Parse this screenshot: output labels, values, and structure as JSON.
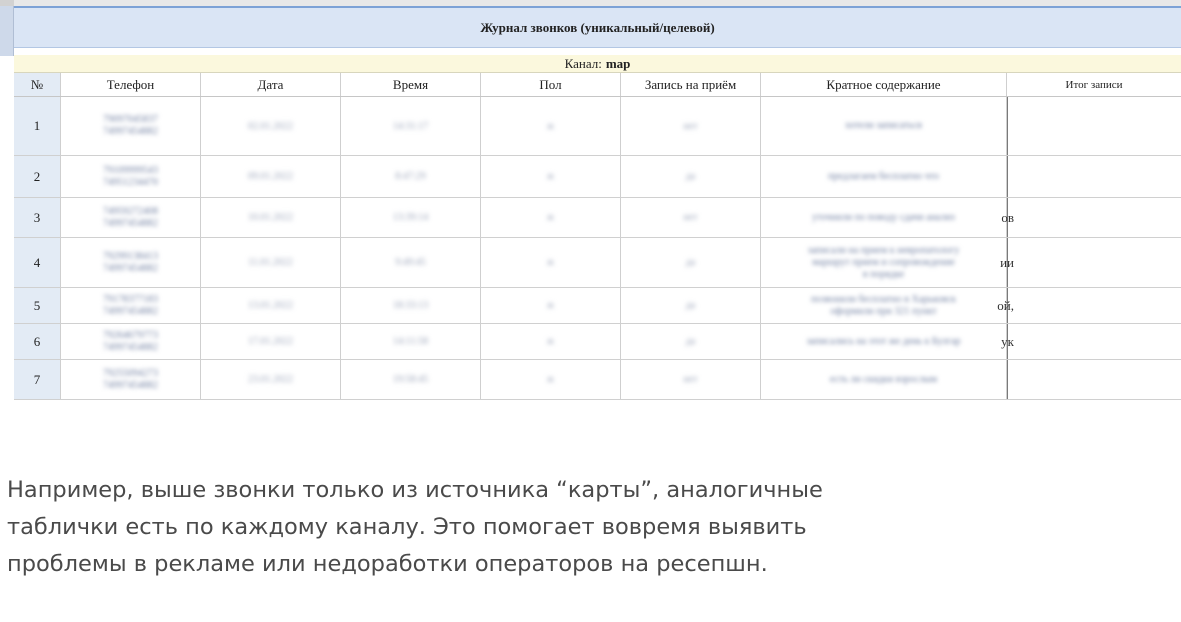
{
  "journal": {
    "title": "Журнал звонков (уникальный/целевой)",
    "channel_label": "Канал:",
    "channel_value": "map"
  },
  "table": {
    "columns": [
      "№",
      "Телефон",
      "Дата",
      "Время",
      "Пол",
      "Запись на приём",
      "Кратное содержание",
      "Итог записи"
    ],
    "rows": [
      {
        "num": "1",
        "phone": [
          "79097045837",
          "74997454882"
        ],
        "date": "02.01.2022",
        "time": "14:31:17",
        "sex": "ж",
        "appt": "нет",
        "summary": [
          "хотели записаться"
        ],
        "tail": ""
      },
      {
        "num": "2",
        "phone": [
          "79109999543",
          "74951234470"
        ],
        "date": "09.01.2022",
        "time": "8:47:29",
        "sex": "ж",
        "appt": "да",
        "summary": [
          "предлагаем бесплатно что"
        ],
        "tail": ""
      },
      {
        "num": "3",
        "phone": [
          "74959272408",
          "74997454882"
        ],
        "date": "10.01.2022",
        "time": "13:39:14",
        "sex": "ж",
        "appt": "нет",
        "summary": [
          "уточнили по поводу сдачи анализ"
        ],
        "tail": "ов"
      },
      {
        "num": "4",
        "phone": [
          "79299138413",
          "74997454882"
        ],
        "date": "11.01.2022",
        "time": "9:49:45",
        "sex": "ж",
        "appt": "да",
        "summary": [
          "записали на прием к невропатологу",
          "маршрут прием и сопровождение",
          "в порядке"
        ],
        "tail": "ии"
      },
      {
        "num": "5",
        "phone": [
          "79178377183",
          "74997454882"
        ],
        "date": "13.01.2022",
        "time": "18:33:13",
        "sex": "ж",
        "appt": "да",
        "summary": [
          "позвонили бесплатно в Харьковск",
          "оформили при 321 пункт"
        ],
        "tail": "ой,"
      },
      {
        "num": "6",
        "phone": [
          "79264679773",
          "74997454882"
        ],
        "date": "17.01.2022",
        "time": "14:11:58",
        "sex": "ж",
        "appt": "да",
        "summary": [
          "записались на этот же день к Булгар"
        ],
        "tail": "ук"
      },
      {
        "num": "7",
        "phone": [
          "79255094273",
          "74997454882"
        ],
        "date": "23.01.2022",
        "time": "19:58:45",
        "sex": "ж",
        "appt": "нет",
        "summary": [
          "есть ли скидки взрослым"
        ],
        "tail": ""
      }
    ]
  },
  "caption": {
    "line1": "Например, выше звонки только из источника “карты”, аналогичные",
    "line2": "таблички есть по каждому каналу. Это помогает вовремя выявить",
    "line3": "проблемы в рекламе или недоработки операторов на ресепшн."
  }
}
